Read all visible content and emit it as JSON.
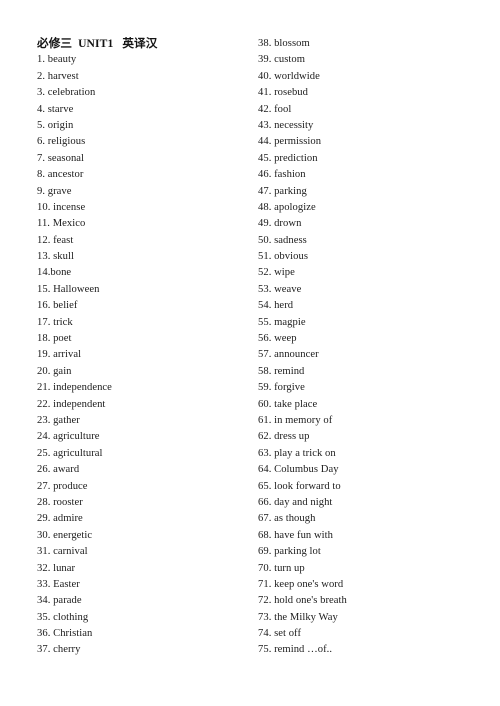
{
  "document": {
    "title": "必修三  UNIT1   英译汉",
    "page_background": "#ffffff",
    "text_color": "#1c1c1c"
  },
  "columns": {
    "left": {
      "items": [
        "1. beauty",
        "2. harvest",
        "3. celebration",
        "4. starve",
        "5. origin",
        "6. religious",
        "7. seasonal",
        "8. ancestor",
        "9. grave",
        "10. incense",
        "11. Mexico",
        "12. feast",
        "13. skull",
        "14.bone",
        "15. Halloween",
        "16. belief",
        "17. trick",
        "18. poet",
        "19. arrival",
        "20. gain",
        "21. independence",
        "22. independent",
        "23. gather",
        "24. agriculture",
        "25. agricultural",
        "26. award",
        "27. produce",
        "28. rooster",
        "29. admire",
        "30. energetic",
        "31. carnival",
        "32. lunar",
        "33. Easter",
        "34. parade",
        "35. clothing",
        "36. Christian",
        "37. cherry"
      ]
    },
    "right": {
      "items": [
        "38. blossom",
        "39. custom",
        "40. worldwide",
        "41. rosebud",
        "42. fool",
        "43. necessity",
        "44. permission",
        "45. prediction",
        "46. fashion",
        "47. parking",
        "48. apologize",
        "49. drown",
        "50. sadness",
        "51. obvious",
        "52. wipe",
        "53. weave",
        "54. herd",
        "55. magpie",
        "56. weep",
        "57. announcer",
        "58. remind",
        "59. forgive",
        "60. take place",
        "61. in memory of",
        "62. dress up",
        "63. play a trick on",
        "64. Columbus Day",
        "65. look forward to",
        "66. day and night",
        "67. as though",
        "68. have fun with",
        "69. parking lot",
        "70. turn up",
        "71. keep one's word",
        "72. hold one's breath",
        "73. the Milky Way",
        "74. set off",
        "75. remind …of.."
      ]
    }
  }
}
